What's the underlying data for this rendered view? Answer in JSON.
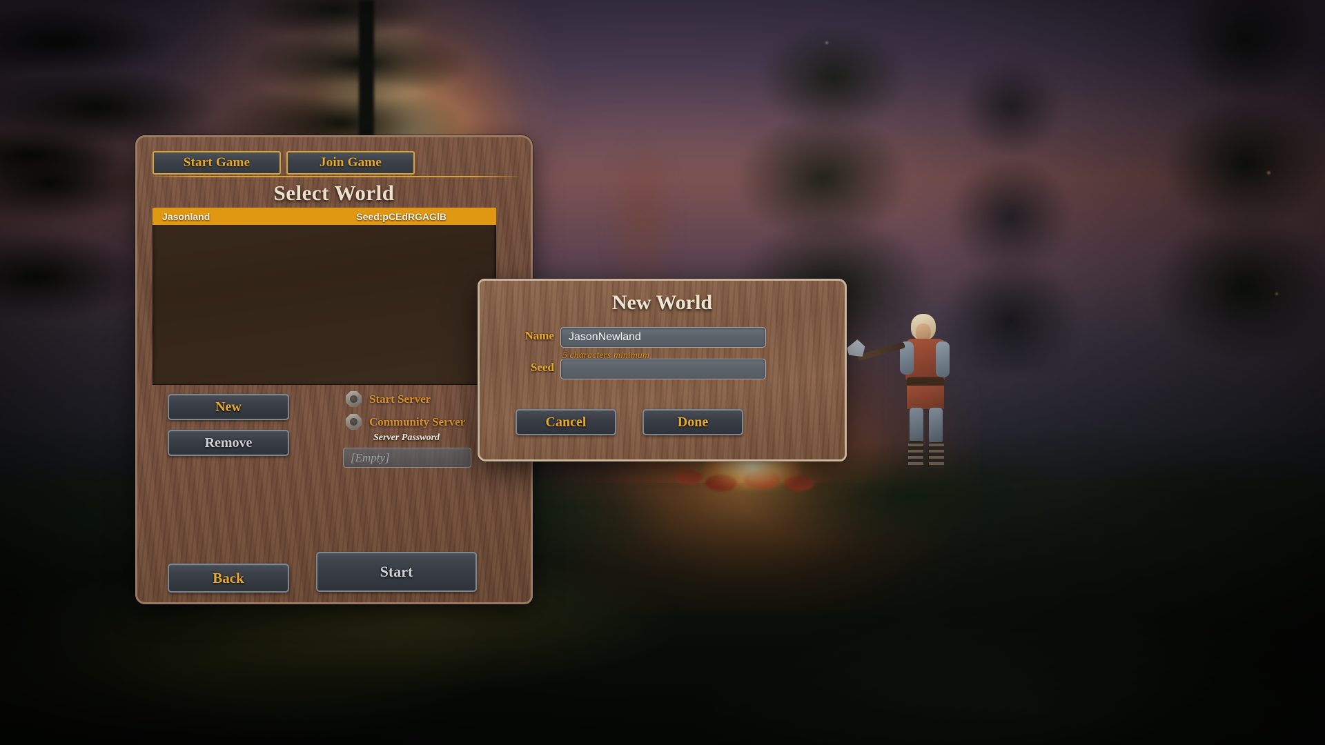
{
  "scene": {
    "description": "Valheim main menu background: dusk forest clearing with campfire and viking character"
  },
  "select_world_panel": {
    "tabs": [
      {
        "label": "Start Game",
        "active": true
      },
      {
        "label": "Join Game",
        "active": false
      }
    ],
    "title": "Select World",
    "world_list": [
      {
        "name": "Jasonland",
        "seed": "Seed:pCEdRGAGlB",
        "selected": true
      }
    ],
    "buttons": {
      "new": "New",
      "remove": "Remove",
      "back": "Back",
      "start": "Start"
    },
    "toggles": [
      {
        "label": "Start Server",
        "checked": false
      },
      {
        "label": "Community Server",
        "checked": false
      }
    ],
    "server_password": {
      "label": "Server Password",
      "value": "",
      "placeholder": "[Empty]"
    }
  },
  "new_world_dialog": {
    "title": "New World",
    "name_label": "Name",
    "name_value": "JasonNewland",
    "name_hint": "5 characters minimum",
    "seed_label": "Seed",
    "seed_value": "",
    "seed_placeholder": "",
    "cancel_label": "Cancel",
    "done_label": "Done"
  },
  "colors": {
    "gold": "#e8a92b",
    "gold_dim": "#d9902a",
    "highlight_row": "#e09712",
    "panel_wood": "#6e4a38",
    "dialog_wood": "#7d573f",
    "parchment_text": "#ede1cc",
    "button_face": "#3a3f47",
    "button_border": "#7b8793",
    "input_face": "#5c626a"
  }
}
